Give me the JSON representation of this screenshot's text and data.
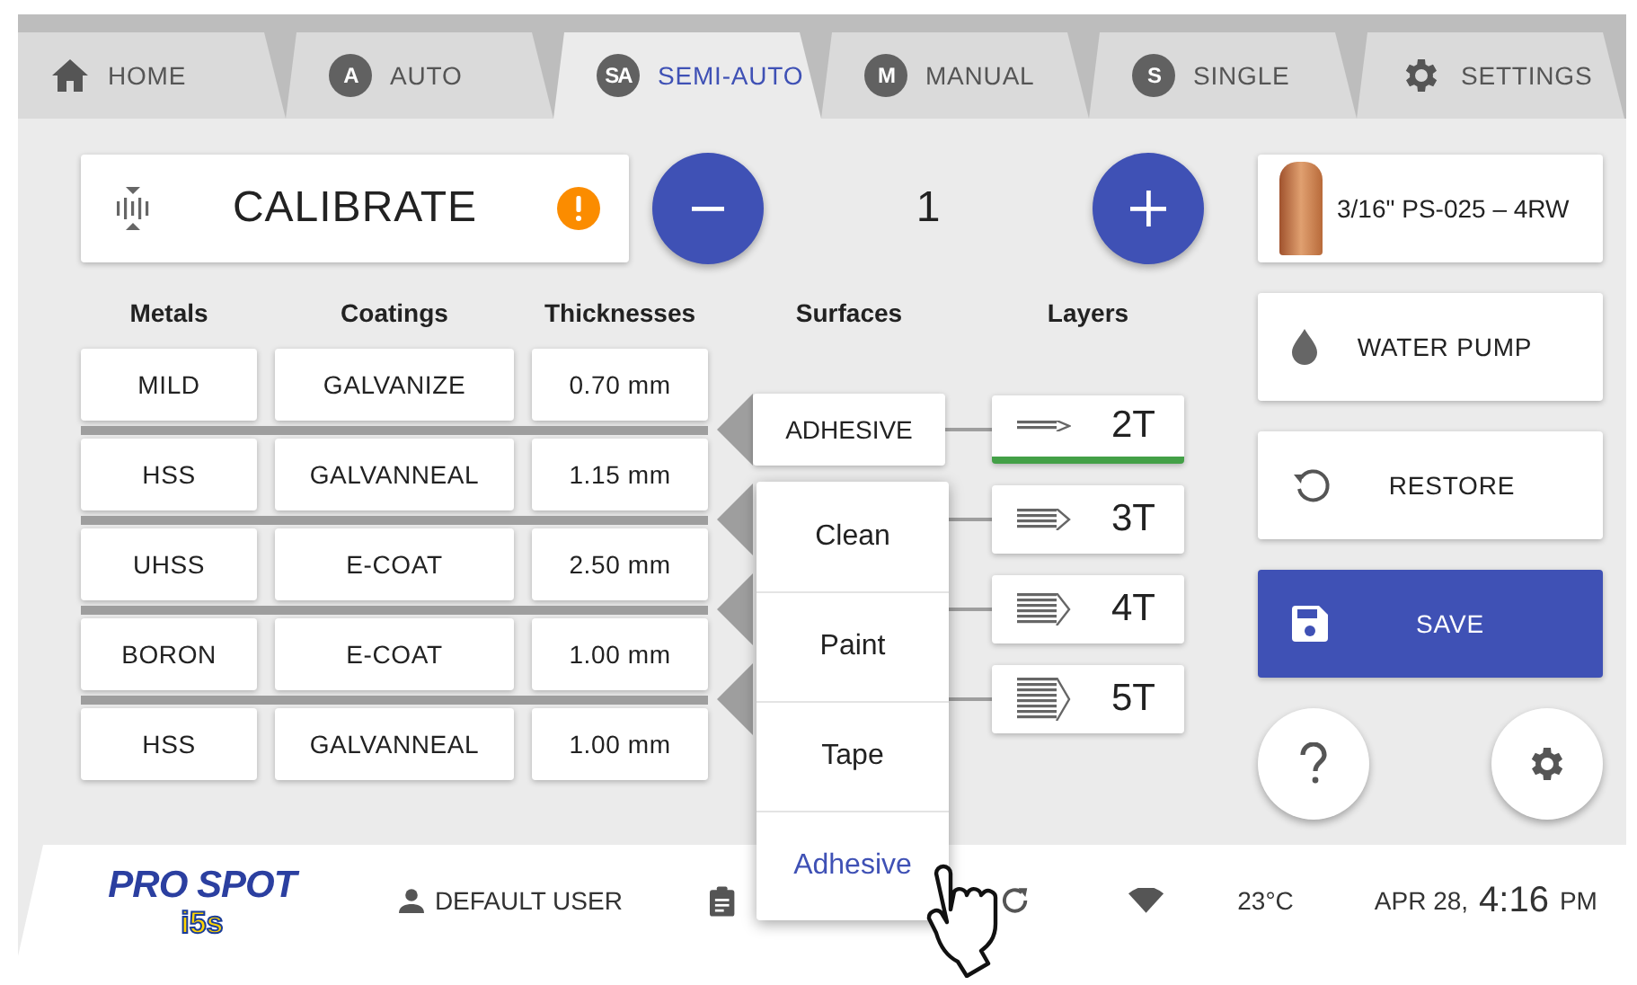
{
  "tabs": [
    {
      "label": "HOME",
      "kind": "home",
      "selected": false
    },
    {
      "label": "AUTO",
      "kind": "letter",
      "badge": "A",
      "selected": false
    },
    {
      "label": "SEMI-AUTO",
      "kind": "letter",
      "badge": "SA",
      "selected": true
    },
    {
      "label": "MANUAL",
      "kind": "letter",
      "badge": "M",
      "selected": false
    },
    {
      "label": "SINGLE",
      "kind": "letter",
      "badge": "S",
      "selected": false
    },
    {
      "label": "SETTINGS",
      "kind": "gear",
      "selected": false
    }
  ],
  "calibrate": {
    "label": "CALIBRATE",
    "warning": true
  },
  "counter": {
    "value": "1"
  },
  "columns": [
    "Metals",
    "Coatings",
    "Thicknesses",
    "Surfaces",
    "Layers"
  ],
  "rows": [
    {
      "metal": "MILD",
      "coating": "GALVANIZE",
      "thickness": "0.70 mm"
    },
    {
      "metal": "HSS",
      "coating": "GALVANNEAL",
      "thickness": "1.15 mm"
    },
    {
      "metal": "UHSS",
      "coating": "E-COAT",
      "thickness": "2.50 mm"
    },
    {
      "metal": "BORON",
      "coating": "E-COAT",
      "thickness": "1.00 mm"
    },
    {
      "metal": "HSS",
      "coating": "GALVANNEAL",
      "thickness": "1.00 mm"
    }
  ],
  "surface": "ADHESIVE",
  "layers": [
    {
      "label": "2T",
      "selected": true
    },
    {
      "label": "3T",
      "selected": false
    },
    {
      "label": "4T",
      "selected": false
    },
    {
      "label": "5T",
      "selected": false
    }
  ],
  "surface_menu": [
    {
      "label": "Clean",
      "selected": false
    },
    {
      "label": "Paint",
      "selected": false
    },
    {
      "label": "Tape",
      "selected": false
    },
    {
      "label": "Adhesive",
      "selected": true
    }
  ],
  "tip": {
    "label": "3/16\" PS-025 – 4RW"
  },
  "actions": [
    {
      "label": "WATER PUMP",
      "kind": "water"
    },
    {
      "label": "RESTORE",
      "kind": "restore"
    },
    {
      "label": "SAVE",
      "kind": "save"
    }
  ],
  "footer": {
    "logo": "PRO SPOT",
    "logo_sub": "i5s",
    "user": "DEFAULT USER",
    "temperature": "23°C",
    "date": "APR 28,",
    "time": "4:16",
    "meridiem": "PM"
  }
}
